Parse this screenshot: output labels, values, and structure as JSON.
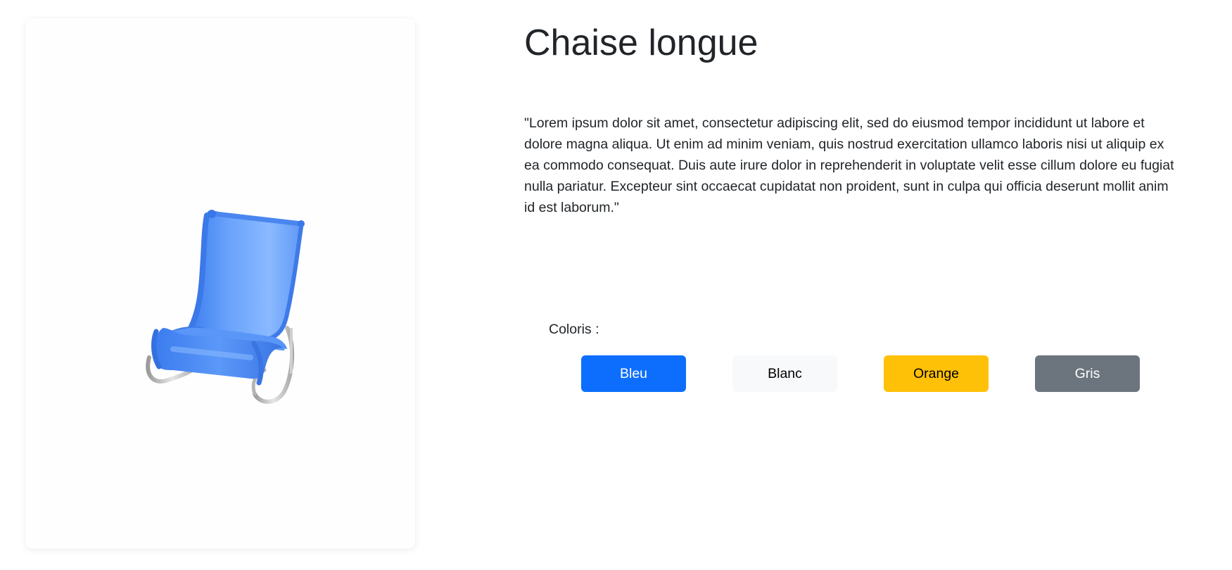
{
  "product": {
    "title": "Chaise longue",
    "description": "\"Lorem ipsum dolor sit amet, consectetur adipiscing elit, sed do eiusmod tempor incididunt ut labore et dolore magna aliqua. Ut enim ad minim veniam, quis nostrud exercitation ullamco laboris nisi ut aliquip ex ea commodo consequat. Duis aute irure dolor in reprehenderit in voluptate velit esse cillum dolore eu fugiat nulla pariatur. Excepteur sint occaecat cupidatat non proident, sunt in culpa qui officia deserunt mollit anim id est laborum.\""
  },
  "colors": {
    "label": "Coloris :",
    "options": [
      {
        "label": "Bleu",
        "background": "#0d6efd",
        "text": "#ffffff"
      },
      {
        "label": "Blanc",
        "background": "#f8f9fa",
        "text": "#000000"
      },
      {
        "label": "Orange",
        "background": "#ffc107",
        "text": "#000000"
      },
      {
        "label": "Gris",
        "background": "#6c757d",
        "text": "#ffffff"
      }
    ]
  },
  "viewer": {
    "model_icon": "chaise-longue-3d-model",
    "selected_color": "#4d8ef7",
    "frame_color": "#c8c8c8"
  }
}
